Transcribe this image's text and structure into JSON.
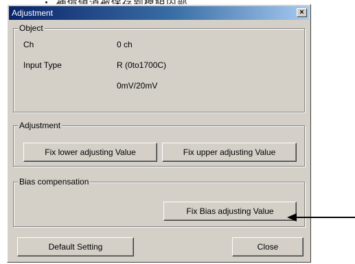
{
  "top_caption": "・ 補償値消被保存到模組内部",
  "dialog": {
    "title": "Adjustment",
    "close_symbol": "×"
  },
  "object_group": {
    "legend": "Object",
    "ch_label": "Ch",
    "ch_value": "0 ch",
    "input_type_label": "Input Type",
    "input_type_value": "R (0to1700C)",
    "range_value": "0mV/20mV"
  },
  "adjustment_group": {
    "legend": "Adjustment",
    "fix_lower_label": "Fix lower adjusting Value",
    "fix_upper_label": "Fix upper adjusting Value"
  },
  "bias_group": {
    "legend": "Bias compensation",
    "fix_bias_label": "Fix Bias adjusting Value"
  },
  "footer": {
    "default_setting_label": "Default Setting",
    "close_label": "Close"
  },
  "colors": {
    "face": "#d4d0c8",
    "title_start": "#0a246a",
    "title_end": "#a6caf0",
    "arrow": "#000000"
  }
}
